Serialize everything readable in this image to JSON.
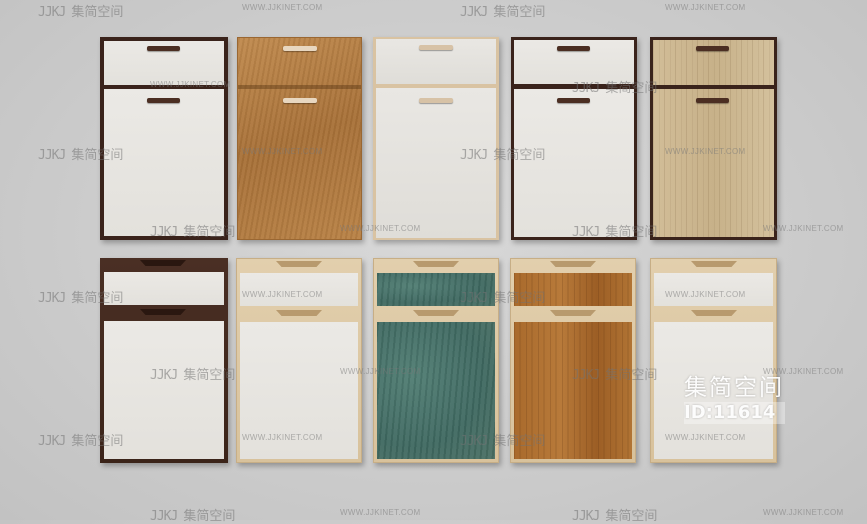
{
  "scene": {
    "description_id": "cabinet-door-samples",
    "watermark_url": "WWW.JJKINET.COM",
    "watermark_logo": "JJKJ",
    "watermark_brand": "集简空间"
  },
  "badge": {
    "title": "集简空间",
    "id_text": "ID:11614"
  }
}
